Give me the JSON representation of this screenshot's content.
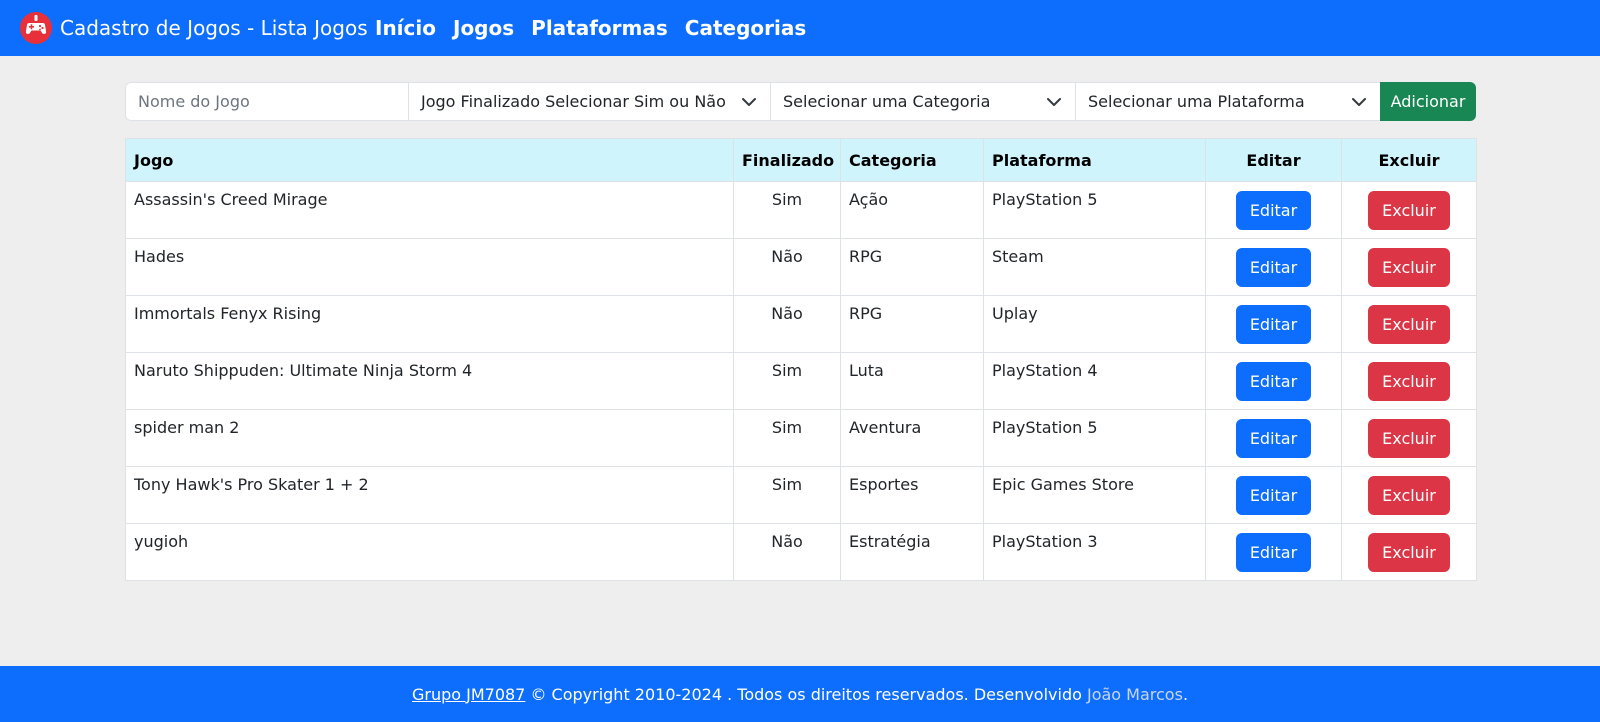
{
  "navbar": {
    "brand_icon": "gamepad-icon",
    "brand_text": "Cadastro de Jogos - Lista Jogos",
    "links": [
      "Início",
      "Jogos",
      "Plataformas",
      "Categorias"
    ],
    "color": "#0d6efd"
  },
  "form": {
    "name_placeholder": "Nome do Jogo",
    "finalizado_select": "Jogo Finalizado Selecionar Sim ou Não",
    "categoria_select": "Selecionar uma Categoria",
    "plataforma_select": "Selecionar uma Plataforma",
    "add_label": "Adicionar"
  },
  "table": {
    "headers": [
      "Jogo",
      "Finalizado",
      "Categoria",
      "Plataforma",
      "Editar",
      "Excluir"
    ],
    "rows": [
      {
        "jogo": "Assassin's Creed Mirage",
        "finalizado": "Sim",
        "categoria": "Ação",
        "plataforma": "PlayStation 5"
      },
      {
        "jogo": "Hades",
        "finalizado": "Não",
        "categoria": "RPG",
        "plataforma": "Steam"
      },
      {
        "jogo": "Immortals Fenyx Rising",
        "finalizado": "Não",
        "categoria": "RPG",
        "plataforma": "Uplay"
      },
      {
        "jogo": "Naruto Shippuden: Ultimate Ninja Storm 4",
        "finalizado": "Sim",
        "categoria": "Luta",
        "plataforma": "PlayStation 4"
      },
      {
        "jogo": "spider man 2",
        "finalizado": "Sim",
        "categoria": "Aventura",
        "plataforma": "PlayStation 5"
      },
      {
        "jogo": "Tony Hawk's Pro Skater 1 + 2",
        "finalizado": "Sim",
        "categoria": "Esportes",
        "plataforma": "Epic Games Store"
      },
      {
        "jogo": "yugioh",
        "finalizado": "Não",
        "categoria": "Estratégia",
        "plataforma": "PlayStation 3"
      }
    ],
    "edit_label": "Editar",
    "delete_label": "Excluir",
    "header_color": "#cff4fc",
    "edit_color": "#0d6efd",
    "delete_color": "#dc3545"
  },
  "footer": {
    "group_link": "Grupo JM7087",
    "copyright": " © Copyright 2010-2024 . Todos os direitos reservados. Desenvolvido ",
    "developer": "João Marcos",
    "end": "."
  }
}
